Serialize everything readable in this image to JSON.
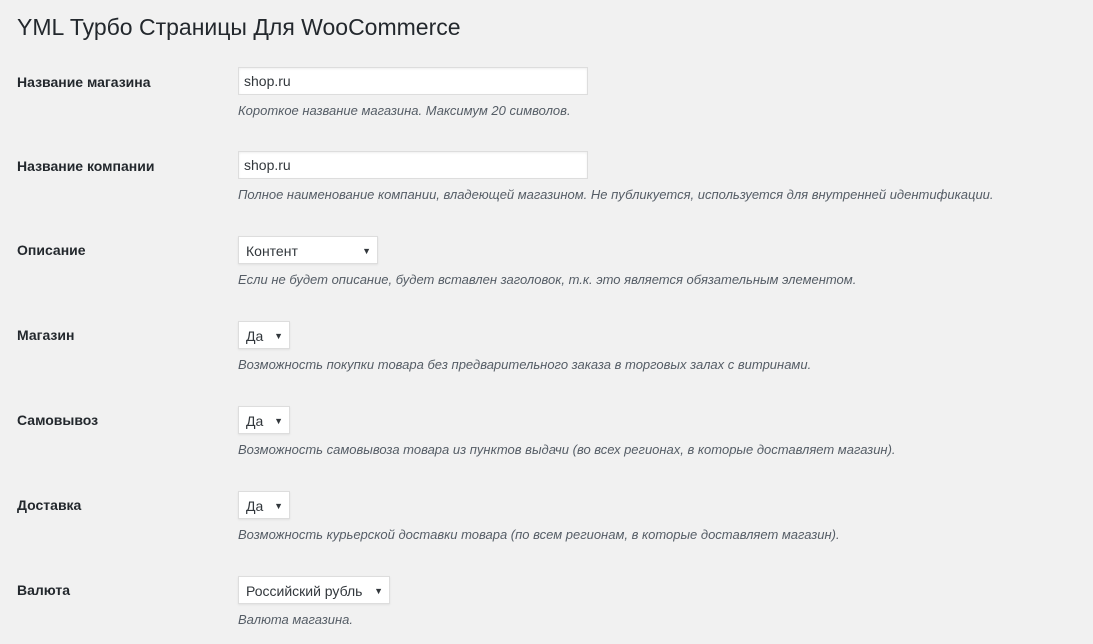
{
  "page": {
    "title": "YML Турбо Страницы Для WooCommerce"
  },
  "settings": [
    {
      "label": "Название магазина",
      "value": "shop.ru",
      "description": "Короткое название магазина. Максимум 20 символов."
    },
    {
      "label": "Название компании",
      "value": "shop.ru",
      "description": "Полное наименование компании, владеющей магазином. Не публикуется, используется для внутренней идентификации."
    },
    {
      "label": "Описание",
      "value": "Контент",
      "description": "Если не будет описание, будет вставлен заголовок, т.к. это является обязательным элементом."
    },
    {
      "label": "Магазин",
      "value": "Да",
      "description": "Возможность покупки товара без предварительного заказа в торговых залах с витринами."
    },
    {
      "label": "Самовывоз",
      "value": "Да",
      "description": "Возможность самовывоза товара из пунктов выдачи (во всех регионах, в которые доставляет магазин)."
    },
    {
      "label": "Доставка",
      "value": "Да",
      "description": "Возможность курьерской доставки товара (по всем регионам, в которые доставляет магазин)."
    },
    {
      "label": "Валюта",
      "value": "Российский рубль",
      "description": "Валюта магазина."
    }
  ],
  "icons": {
    "select_arrow": "▼"
  }
}
